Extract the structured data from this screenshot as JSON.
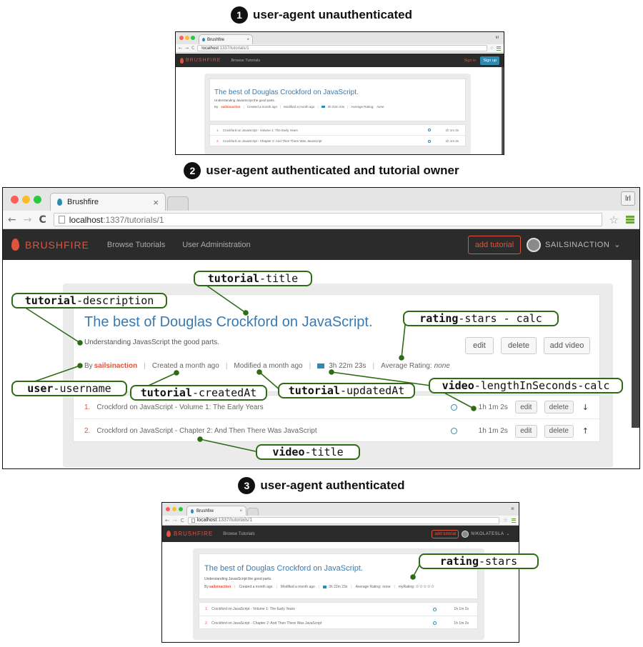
{
  "steps": [
    {
      "number": "1",
      "label": "user-agent unauthenticated"
    },
    {
      "number": "2",
      "label": "user-agent authenticated and tutorial owner"
    },
    {
      "number": "3",
      "label": "user-agent authenticated"
    }
  ],
  "browser": {
    "tab_title": "Brushfire",
    "tab_close": "×",
    "profile_button": "lrl",
    "url_host": "localhost",
    "url_path": ":1337/tutorials/1",
    "back": "←",
    "forward": "→",
    "reload": "C",
    "bookmark": "☆"
  },
  "navbar": {
    "brand": "BRUSHFIRE",
    "browse": "Browse Tutorials",
    "user_admin": "User Administration",
    "sign_in": "Sign in",
    "sign_up": "Sign up",
    "add_tutorial": "add tutorial",
    "username_owner": "SAILSINACTION",
    "username_other": "NIKOLATESLA",
    "caret": "⌄"
  },
  "tutorial": {
    "title": "The best of Douglas Crockford on JavaScript.",
    "description": "Understanding JavasScript the good parts.",
    "by": "By",
    "username": "sailsinaction",
    "created": "Created a month ago",
    "modified": "Modified a month ago",
    "length": "3h 22m 23s",
    "rating_label": "Average Rating:",
    "rating_value": "none",
    "my_rating": "myRating:",
    "my_rating_stars": "☆☆☆☆☆",
    "sep": "|",
    "buttons": {
      "edit": "edit",
      "delete": "delete",
      "add_video": "add video"
    }
  },
  "videos": [
    {
      "num": "1.",
      "title": "Crockford on JavaScript - Volume 1: The Early Years",
      "length": "1h 1m 2s",
      "move": "↓"
    },
    {
      "num": "2.",
      "title": "Crockford on JavaScript - Chapter 2: And Then There Was JavaScript",
      "length": "1h 1m 2s",
      "move": "↑"
    }
  ],
  "row_buttons": {
    "edit": "edit",
    "delete": "delete"
  },
  "callouts": {
    "tutorial_title": [
      "tutorial",
      "-title"
    ],
    "tutorial_description": [
      "tutorial",
      "-description"
    ],
    "rating_stars_calc": [
      "rating",
      "-stars - calc"
    ],
    "user_username": [
      "user",
      "-username"
    ],
    "tutorial_createdAt": [
      "tutorial",
      "-createdAt"
    ],
    "tutorial_updatedAt": [
      "tutorial",
      "-updatedAt"
    ],
    "video_length": [
      "video",
      "-lengthInSeconds-calc"
    ],
    "video_title": [
      "video",
      "-title"
    ],
    "rating_stars": [
      "rating",
      "-stars"
    ]
  },
  "colors": {
    "brand": "#e0533c",
    "link": "#3a7ab0",
    "callout_border": "#2e6b14",
    "menu_green": "#6ba43a"
  }
}
